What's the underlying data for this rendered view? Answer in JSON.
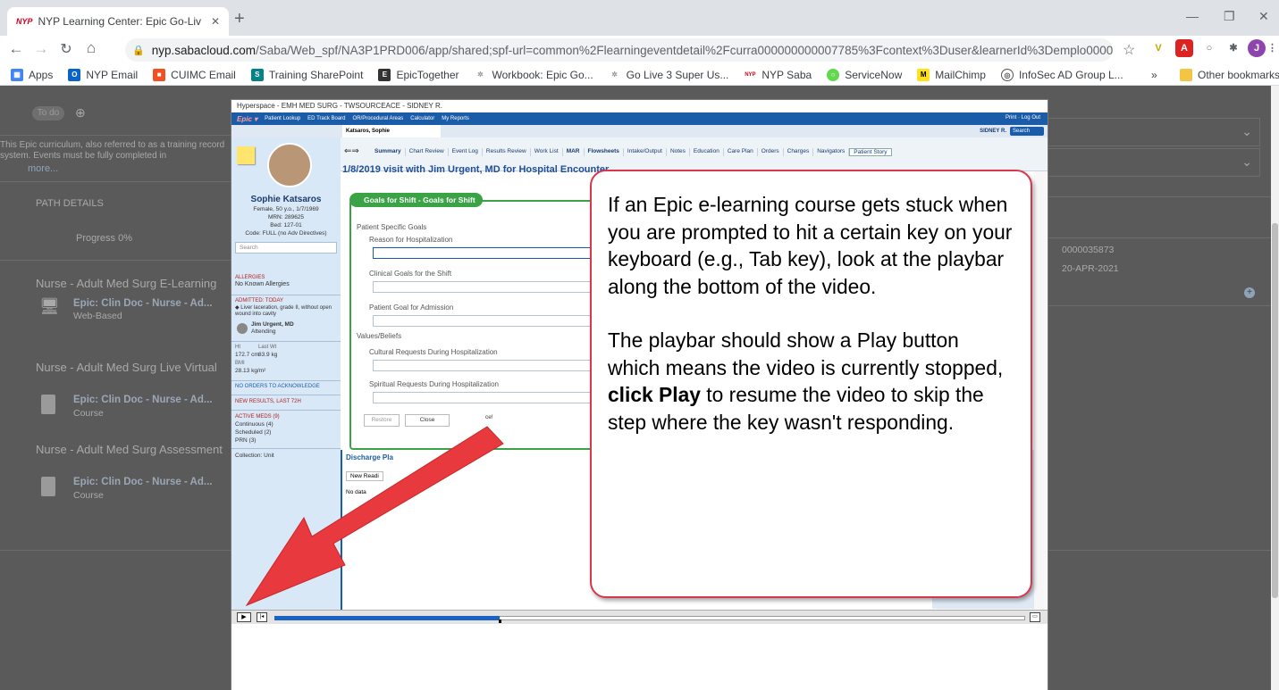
{
  "browser": {
    "tab_title": "NYP Learning Center: Epic Go-Liv",
    "tab_favicon": "NYP",
    "url_host": "nyp.sabacloud.com",
    "url_path": "/Saba/Web_spf/NA3P1PRD006/app/shared;spf-url=common%2Flearningeventdetail%2Fcurra000000000007785%3Fcontext%3Duser&learnerId%3Demplo000000000003007...",
    "bookmarks": [
      "Apps",
      "NYP Email",
      "CUIMC Email",
      "Training SharePoint",
      "EpicTogether",
      "Workbook: Epic Go...",
      "Go Live 3 Super Us...",
      "NYP Saba",
      "ServiceNow",
      "MailChimp",
      "InfoSec AD Group L..."
    ],
    "bookmark_overflow": "»",
    "other_bookmarks": "Other bookmarks",
    "profile_initial": "J"
  },
  "saba": {
    "todo": "To do",
    "description": "This Epic curriculum, also referred to as a training record system. Events must be fully completed in",
    "more": "more...",
    "path_details": "PATH DETAILS",
    "progress": "Progress 0%",
    "items": [
      {
        "type": "heading",
        "text": "Nurse - Adult Med Surg E-Learning"
      },
      {
        "type": "course",
        "title": "Epic: Clin Doc - Nurse - Ad...",
        "sub": "Web-Based"
      },
      {
        "type": "heading",
        "text": "Nurse - Adult Med Surg Live Virtual"
      },
      {
        "type": "course",
        "title": "Epic: Clin Doc - Nurse - Ad...",
        "sub": "Course"
      },
      {
        "type": "heading",
        "text": "Nurse - Adult Med Surg Assessment"
      },
      {
        "type": "course",
        "title": "Epic: Clin Doc - Nurse - Ad...",
        "sub": "Course"
      }
    ],
    "right_id": "0000035873",
    "right_date": "20-APR-2021"
  },
  "epic": {
    "window_title": "Hyperspace - EMH MED SURG - TWSOURCEACE - SIDNEY R.",
    "menu": [
      "Epic ▾",
      "Patient Lookup",
      "ED Track Board",
      "OR/Procedural Areas",
      "Calculator",
      "My Reports"
    ],
    "menu_right": "Print · Log Out",
    "patient_tab": "Katsaros, Sophie",
    "user": "SIDNEY R.",
    "search": "Search",
    "activities": [
      "Summary",
      "Chart Review",
      "Event Log",
      "Results Review",
      "Work List",
      "MAR",
      "Flowsheets",
      "Intake/Output",
      "Notes",
      "Education",
      "Care Plan",
      "Orders",
      "Charges",
      "Navigators",
      "Patient Story"
    ],
    "visit": "1/8/2019 visit with Jim Urgent, MD for Hospital Encounter",
    "patient": {
      "name": "Sophie Katsaros",
      "demo": "Female, 50 y.o., 1/7/1969",
      "mrn": "MRN: 289625",
      "bed": "Bed: 127-01",
      "code": "Code: FULL (no Adv Directives)",
      "search": "Search",
      "allergies_label": "ALLERGIES",
      "allergies": "No Known Allergies",
      "admitted": "ADMITTED: TODAY",
      "dx": "◆ Liver laceration, grade II, without open wound into cavity",
      "attending_name": "Jim Urgent, MD",
      "attending_role": "Attending",
      "ht_label": "Ht",
      "ht": "172.7 cm",
      "wt_label": "Last Wt",
      "wt": "83.9 kg",
      "bmi_label": "BMI",
      "bmi": "28.13 kg/m²",
      "orders": "NO ORDERS TO ACKNOWLEDGE",
      "new_results": "NEW RESULTS, LAST 72H",
      "meds": "ACTIVE MEDS (9)",
      "continuous": "Continuous (4)",
      "scheduled": "Scheduled (2)",
      "prn": "PRN (3)",
      "collection": "Collection: Unit"
    },
    "goals": {
      "header": "Goals for Shift - Goals for Shift",
      "section1": "Patient Specific Goals",
      "f1": "Reason for Hospitalization",
      "f2": "Clinical Goals for the Shift",
      "f3": "Patient Goal for Admission",
      "section2": "Values/Beliefs",
      "f4": "Cultural Requests During Hospitalization",
      "f5": "Spiritual Requests During Hospitalization",
      "restore": "Restore",
      "close": "Close",
      "cancel": "ce!"
    },
    "discharge": {
      "header": "Discharge Pla",
      "new": "New Readi",
      "nodata": "No data"
    },
    "progress_fraction": 0.3
  },
  "callout": {
    "p1": "If an Epic e-learning course gets stuck when you are prompted to hit a certain key on your keyboard (e.g., Tab key), look at the playbar along the bottom of the video.",
    "p2a": "The playbar should show a Play button which means the video is currently stopped, ",
    "p2b": "click Play",
    "p2c": " to resume the video to skip the step where the key wasn't responding."
  },
  "colors": {
    "arrow": "#e8393f",
    "callout_border": "#d9374c",
    "epic_blue": "#1b5ca9",
    "goals_green": "#3aa346"
  }
}
